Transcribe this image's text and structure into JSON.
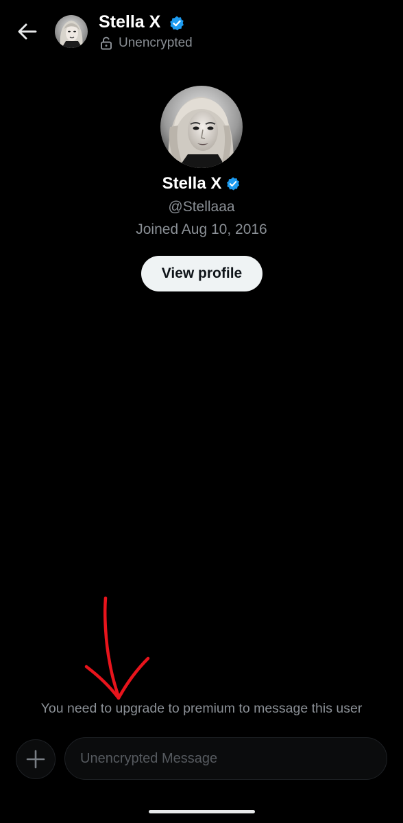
{
  "header": {
    "name": "Stella X",
    "status": "Unencrypted"
  },
  "profile": {
    "name": "Stella X",
    "handle": "@Stellaaa",
    "joined": "Joined Aug 10, 2016",
    "view_profile_label": "View profile"
  },
  "notice": "You need to upgrade to premium to message this user",
  "composer": {
    "placeholder": "Unencrypted Message"
  },
  "icons": {
    "back": "arrow-left-icon",
    "verified": "verified-badge-icon",
    "lock": "lock-icon",
    "add": "plus-icon"
  },
  "colors": {
    "background": "#000000",
    "verified": "#1d9bf0",
    "annotation": "#e8141c",
    "muted_text": "#8b9096"
  }
}
